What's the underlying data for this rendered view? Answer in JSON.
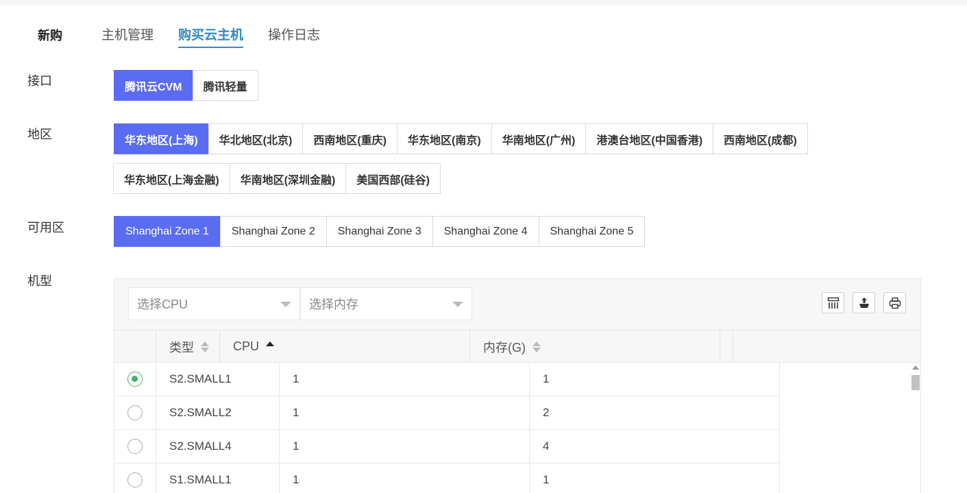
{
  "nav": {
    "new_label": "新购",
    "tabs": [
      {
        "label": "主机管理",
        "active": false
      },
      {
        "label": "购买云主机",
        "active": true
      },
      {
        "label": "操作日志",
        "active": false
      }
    ]
  },
  "api": {
    "label": "接口",
    "options": [
      "腾讯云CVM",
      "腾讯轻量"
    ],
    "selected": "腾讯云CVM"
  },
  "region": {
    "label": "地区",
    "row1": [
      "华东地区(上海)",
      "华北地区(北京)",
      "西南地区(重庆)",
      "华东地区(南京)",
      "华南地区(广州)",
      "港澳台地区(中国香港)",
      "西南地区(成都)"
    ],
    "row2": [
      "华东地区(上海金融)",
      "华南地区(深圳金融)",
      "美国西部(硅谷)"
    ],
    "selected": "华东地区(上海)"
  },
  "zone": {
    "label": "可用区",
    "options": [
      "Shanghai Zone 1",
      "Shanghai Zone 2",
      "Shanghai Zone 3",
      "Shanghai Zone 4",
      "Shanghai Zone 5"
    ],
    "selected": "Shanghai Zone 1"
  },
  "machine": {
    "label": "机型",
    "cpu_placeholder": "选择CPU",
    "mem_placeholder": "选择内存",
    "tools": [
      "columns-icon",
      "export-icon",
      "print-icon"
    ],
    "columns": {
      "type": "类型",
      "cpu": "CPU",
      "mem": "内存(G)"
    },
    "rows": [
      {
        "type": "S2.SMALL1",
        "cpu": "1",
        "mem": "1",
        "checked": true
      },
      {
        "type": "S2.SMALL2",
        "cpu": "1",
        "mem": "2",
        "checked": false
      },
      {
        "type": "S2.SMALL4",
        "cpu": "1",
        "mem": "4",
        "checked": false
      },
      {
        "type": "S1.SMALL1",
        "cpu": "1",
        "mem": "1",
        "checked": false
      }
    ]
  },
  "colors": {
    "primary": "#5a6cf2",
    "tab_active": "#2d8cc7",
    "radio": "#4cae6c"
  }
}
